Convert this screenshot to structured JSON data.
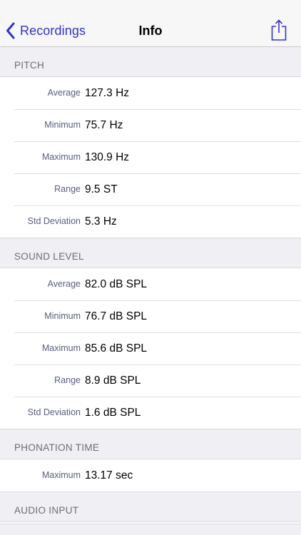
{
  "navbar": {
    "back_label": "Recordings",
    "title": "Info",
    "icons": {
      "back": "chevron-left-icon",
      "share": "share-icon"
    },
    "accent_color": "#3434c8"
  },
  "sections": [
    {
      "header": "PITCH",
      "rows": [
        {
          "label": "Average",
          "value": "127.3 Hz"
        },
        {
          "label": "Minimum",
          "value": "75.7 Hz"
        },
        {
          "label": "Maximum",
          "value": "130.9 Hz"
        },
        {
          "label": "Range",
          "value": "9.5 ST"
        },
        {
          "label": "Std Deviation",
          "value": "5.3 Hz"
        }
      ]
    },
    {
      "header": "SOUND LEVEL",
      "rows": [
        {
          "label": "Average",
          "value": "82.0 dB SPL"
        },
        {
          "label": "Minimum",
          "value": "76.7 dB SPL"
        },
        {
          "label": "Maximum",
          "value": "85.6 dB SPL"
        },
        {
          "label": "Range",
          "value": "8.9 dB SPL"
        },
        {
          "label": "Std Deviation",
          "value": "1.6 dB SPL"
        }
      ]
    },
    {
      "header": "PHONATION TIME",
      "rows": [
        {
          "label": "Maximum",
          "value": "13.17 sec"
        }
      ]
    },
    {
      "header": "AUDIO INPUT",
      "rows": []
    }
  ]
}
